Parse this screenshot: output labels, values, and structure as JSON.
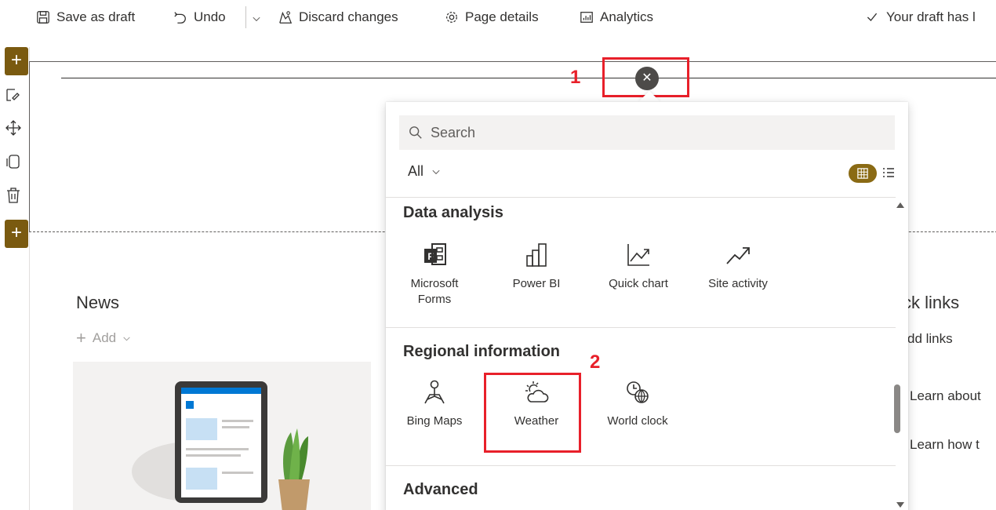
{
  "toolbar": {
    "save_draft": "Save as draft",
    "undo": "Undo",
    "discard": "Discard changes",
    "page_details": "Page details",
    "analytics": "Analytics",
    "status": "Your draft has l"
  },
  "annotations": {
    "marker_1": "1",
    "marker_2": "2",
    "highlight_color": "#e8202a"
  },
  "page": {
    "news_title": "News",
    "news_add": "Add",
    "quick_links_title": "ck links",
    "quick_links_add": "dd links",
    "quick_link_1": "Learn about",
    "quick_link_2": "Learn how t"
  },
  "toolbox": {
    "search_placeholder": "Search",
    "filter_value": "All",
    "categories": [
      {
        "title": "Data analysis",
        "items": [
          {
            "label": "Microsoft Forms",
            "icon": "forms-icon"
          },
          {
            "label": "Power BI",
            "icon": "powerbi-icon"
          },
          {
            "label": "Quick chart",
            "icon": "quick-chart-icon"
          },
          {
            "label": "Site activity",
            "icon": "site-activity-icon"
          }
        ]
      },
      {
        "title": "Regional information",
        "items": [
          {
            "label": "Bing Maps",
            "icon": "bing-maps-icon"
          },
          {
            "label": "Weather",
            "icon": "weather-icon"
          },
          {
            "label": "World clock",
            "icon": "world-clock-icon"
          }
        ]
      },
      {
        "title": "Advanced",
        "items": []
      }
    ]
  },
  "colors": {
    "accent": "#7a5a10",
    "toggle": "#8a6a14"
  }
}
